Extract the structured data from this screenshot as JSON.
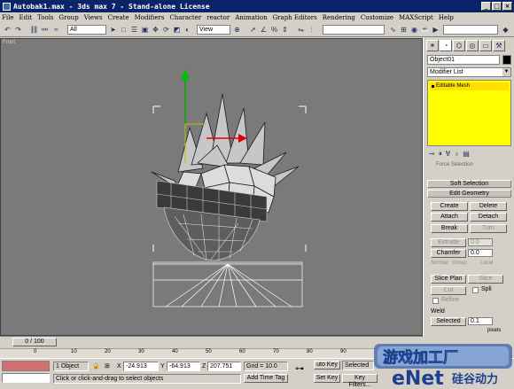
{
  "window": {
    "title": "Autobak1.max - 3ds max 7 - Stand-alone License",
    "controls": [
      "_",
      "□",
      "×"
    ]
  },
  "menu": [
    "File",
    "Edit",
    "Tools",
    "Group",
    "Views",
    "Create",
    "Modifiers",
    "Character",
    "reactor",
    "Animation",
    "Graph Editors",
    "Rendering",
    "Customize",
    "MAXScript",
    "Help"
  ],
  "toolbar": {
    "selection_filter": "All",
    "ref_coord": "View"
  },
  "viewport": {
    "label": "Front"
  },
  "command_panel": {
    "object_name": "Object01",
    "object_color": "#000000",
    "modifier_list": "Modifier List",
    "stack_item": "Editable Mesh",
    "stack_color": "#ffff00",
    "scroll_caption": "Force Selection",
    "rollouts": {
      "soft_selection": "Soft Selection",
      "edit_geometry": "Edit Geometry"
    },
    "buttons": {
      "create": "Create",
      "delete": "Delete",
      "attach": "Attach",
      "detach": "Detach",
      "break": "Break",
      "turn": "Turn"
    },
    "extrude": {
      "label": "Extrude",
      "value": "0.0"
    },
    "chamfer": {
      "label": "Chamfer",
      "value": "0.0"
    },
    "normal": {
      "label": "Normal:",
      "group": "Group",
      "local": "Local"
    },
    "slice_plane": "Slice Plan",
    "slice": "Slice",
    "cut": "Cut",
    "split": "Spli",
    "refine": "Refine",
    "weld": {
      "group": "Weld",
      "selected": "Selected",
      "value": "0.1",
      "units": "pixels"
    }
  },
  "timeline": {
    "slider": "0 / 100",
    "ticks": [
      "0",
      "10",
      "20",
      "30",
      "40",
      "50",
      "60",
      "70",
      "80",
      "90"
    ]
  },
  "status": {
    "selection": "1 Object",
    "x_label": "X",
    "x": "-24.913",
    "y_label": "Y",
    "y": "-64.913",
    "z_label": "Z",
    "z": "207.751",
    "grid": "Grid = 10.0",
    "auto_key": "uto Key",
    "selected": "Selected",
    "prompt": "Click or click-and-drag to select objects",
    "add_time_tag": "Add Time Tag",
    "set_key": "Set Key",
    "key_filters": "Key Filters..."
  },
  "watermark": {
    "brand": "eNet",
    "cn_text": "硅谷动力",
    "game_cn": "游戏加工厂"
  }
}
